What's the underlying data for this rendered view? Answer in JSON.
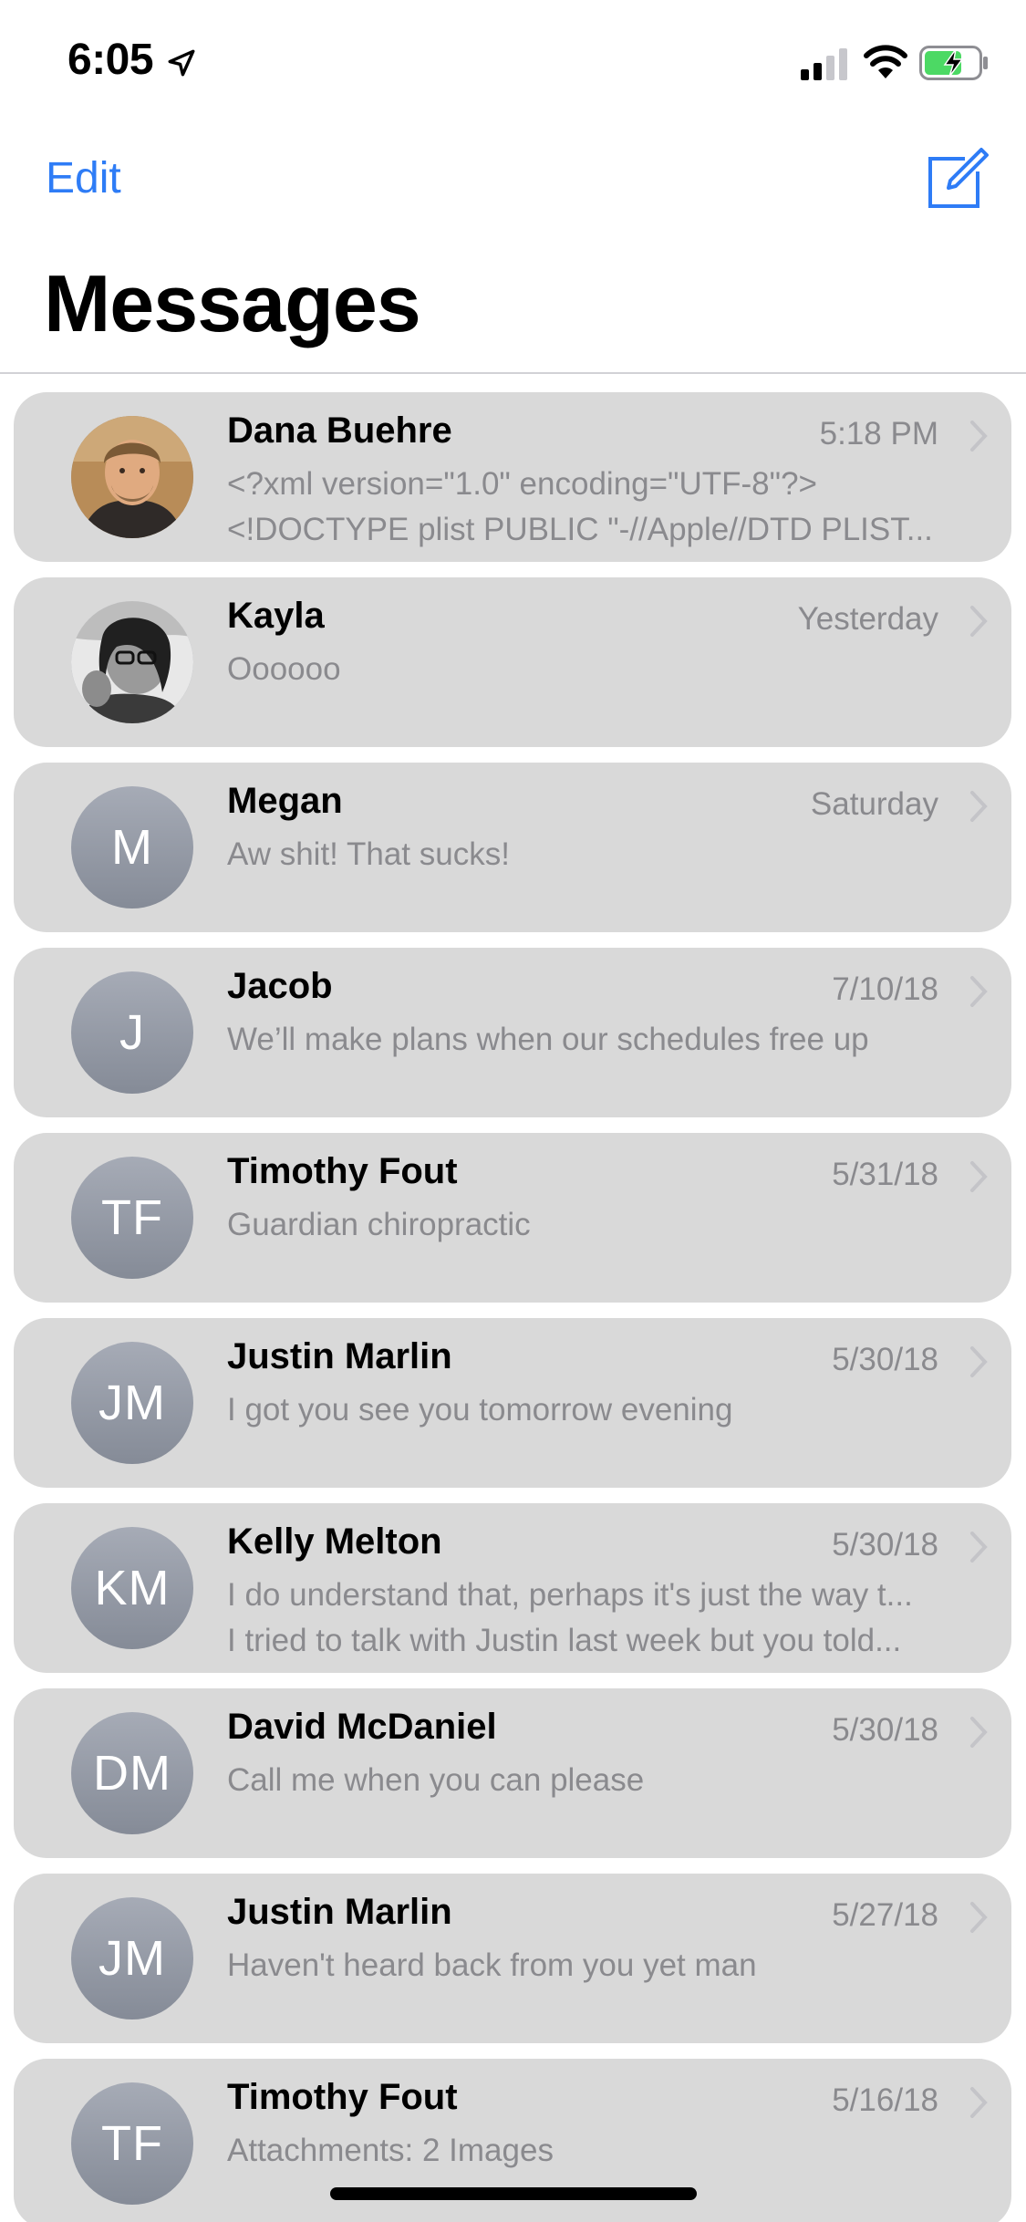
{
  "status_bar": {
    "time": "6:05",
    "icons": [
      "location-arrow-icon",
      "cellular-signal-icon",
      "wifi-icon",
      "battery-charging-icon"
    ]
  },
  "nav": {
    "edit_label": "Edit",
    "compose_icon": "compose-icon",
    "title": "Messages"
  },
  "colors": {
    "accent": "#2e7cf6",
    "row_background": "#d9d9d9",
    "secondary_text": "#8a8a8e",
    "battery_charge": "#4cd964"
  },
  "conversations": [
    {
      "name": "Dana Buehre",
      "time": "5:18 PM",
      "preview": [
        "<?xml version=\"1.0\" encoding=\"UTF-8\"?>",
        "<!DOCTYPE plist PUBLIC \"-//Apple//DTD PLIST..."
      ],
      "avatar": "photo"
    },
    {
      "name": "Kayla",
      "time": "Yesterday",
      "preview": [
        "Oooooo"
      ],
      "avatar": "photo"
    },
    {
      "name": "Megan",
      "time": "Saturday",
      "preview": [
        "Aw shit! That sucks!"
      ],
      "initials": "M"
    },
    {
      "name": "Jacob",
      "time": "7/10/18",
      "preview": [
        "We’ll make plans when our schedules free up"
      ],
      "initials": "J"
    },
    {
      "name": "Timothy Fout",
      "time": "5/31/18",
      "preview": [
        "Guardian chiropractic"
      ],
      "initials": "TF"
    },
    {
      "name": "Justin Marlin",
      "time": "5/30/18",
      "preview": [
        "I got you see you tomorrow evening"
      ],
      "initials": "JM"
    },
    {
      "name": "Kelly Melton",
      "time": "5/30/18",
      "preview": [
        "I do understand that, perhaps it's just the way t...",
        "I tried to talk with Justin last week but you told..."
      ],
      "initials": "KM"
    },
    {
      "name": "David McDaniel",
      "time": "5/30/18",
      "preview": [
        "Call me when you can please"
      ],
      "initials": "DM"
    },
    {
      "name": "Justin Marlin",
      "time": "5/27/18",
      "preview": [
        "Haven't heard back from you yet man"
      ],
      "initials": "JM"
    },
    {
      "name": "Timothy Fout",
      "time": "5/16/18",
      "preview": [
        "Attachments: 2 Images"
      ],
      "initials": "TF"
    }
  ]
}
